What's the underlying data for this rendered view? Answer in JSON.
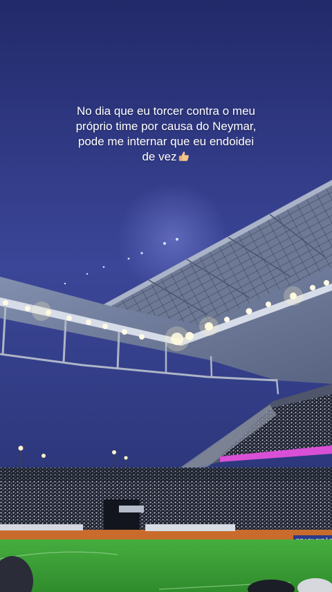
{
  "caption": {
    "line1": "No dia que eu torcer contra o meu",
    "line2": "próprio time por causa do Neymar,",
    "line3": "pode me internar que eu endoidei",
    "line4": "de vez",
    "emoji": "thumbs-up-icon"
  },
  "banners": {
    "ad_board_right": "BRASILEIRÃO"
  },
  "colors": {
    "sky_top": "#252c6e",
    "sky_bottom": "#3a4596",
    "pitch": "#3fa43a",
    "ad_band": "#d94fd6"
  }
}
